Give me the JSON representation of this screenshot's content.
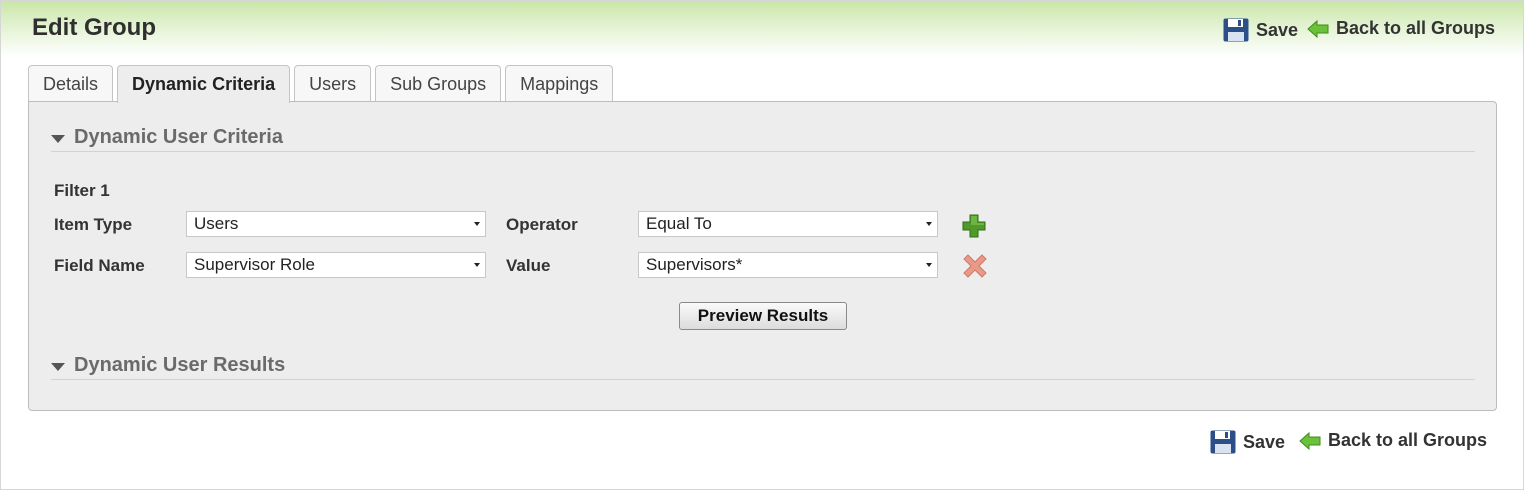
{
  "header": {
    "title": "Edit Group",
    "save_label": "Save",
    "back_label": "Back to all Groups"
  },
  "tabs": [
    {
      "label": "Details",
      "active": false
    },
    {
      "label": "Dynamic Criteria",
      "active": true
    },
    {
      "label": "Users",
      "active": false
    },
    {
      "label": "Sub Groups",
      "active": false
    },
    {
      "label": "Mappings",
      "active": false
    }
  ],
  "criteria": {
    "section_title": "Dynamic User Criteria",
    "filter_title": "Filter 1",
    "item_type_label": "Item Type",
    "item_type_value": "Users",
    "operator_label": "Operator",
    "operator_value": "Equal To",
    "field_name_label": "Field Name",
    "field_name_value": "Supervisor Role",
    "value_label": "Value",
    "value_value": "Supervisors*",
    "preview_label": "Preview Results"
  },
  "results": {
    "section_title": "Dynamic User Results"
  },
  "footer": {
    "save_label": "Save",
    "back_label": "Back to all Groups"
  },
  "colors": {
    "header_gradient_top": "#c9e6a8",
    "add_icon": "#4f9a2a",
    "remove_icon": "#e89a8a",
    "save_icon": "#2c4f8a",
    "back_arrow": "#69c23a"
  },
  "icons": [
    "save-icon",
    "back-arrow-icon",
    "add-filter-icon",
    "remove-filter-icon",
    "collapse-triangle-icon",
    "dropdown-caret-icon"
  ]
}
